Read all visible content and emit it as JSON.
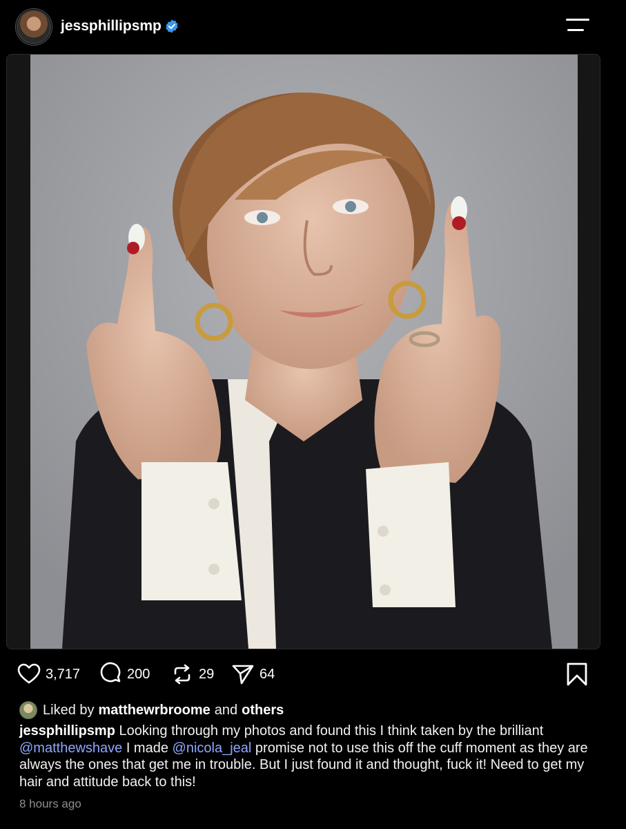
{
  "header": {
    "username": "jessphillipsmp",
    "verified_icon": "verified-badge-icon",
    "menu_icon": "menu-icon",
    "accent_color": "#3897f0"
  },
  "post": {
    "image_icon": "post-photo",
    "stats": {
      "likes": "3,717",
      "comments": "200",
      "reposts": "29",
      "shares": "64"
    },
    "liked_by": {
      "prefix": "Liked by",
      "user": "matthewrbroome",
      "connector": "and",
      "suffix": "others"
    },
    "caption": {
      "author": "jessphillipsmp",
      "part1": " Looking through my photos and found this I think taken by the brilliant ",
      "mention1": "@matthewshave",
      "part2": " I made ",
      "mention2": "@nicola_jeal",
      "part3": " promise not to use this off the cuff moment as they are always the ones that get me in trouble. But I just found it and thought, fuck it! Need to get my hair  and attitude back to this!"
    },
    "timestamp": "8 hours ago",
    "mention_color": "#8ea8ff"
  }
}
